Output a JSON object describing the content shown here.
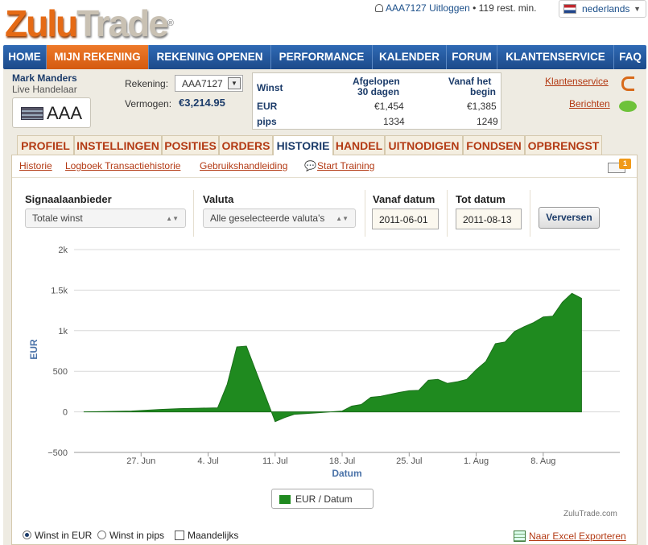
{
  "brand": {
    "logo_part1": "Zulu",
    "logo_part2": "Trade",
    "reg": "®"
  },
  "topbar": {
    "user": "AAA7127",
    "logout": "Uitloggen",
    "remaining": "• 119 rest. min.",
    "language": "nederlands",
    "lang_flag": "dutch-flag-icon"
  },
  "nav": [
    "HOME",
    "MIJN REKENING",
    "REKENING OPENEN",
    "PERFORMANCE",
    "KALENDER",
    "FORUM",
    "KLANTENSERVICE",
    "FAQ"
  ],
  "account": {
    "name": "Mark Manders",
    "type": "Live Handelaar",
    "badge": "AAA",
    "rekening_label": "Rekening:",
    "rekening_value": "AAA7127",
    "vermogen_label": "Vermogen:",
    "vermogen_value": "€3,214.95"
  },
  "stats": {
    "h_winst": "Winst",
    "h_col1": "Afgelopen",
    "h_col1b": "30 dagen",
    "h_col2": "Vanaf het",
    "h_col2b": "begin",
    "eur_label": "EUR",
    "eur_30": "€1,454",
    "eur_all": "€1,385",
    "pips_label": "pips",
    "pips_30": "1334",
    "pips_all": "1249"
  },
  "right_links": {
    "klantenservice": "Klantenservice",
    "berichten": "Berichten"
  },
  "tabs": [
    "PROFIEL",
    "INSTELLINGEN",
    "POSITIES",
    "ORDERS",
    "HISTORIE",
    "HANDEL",
    "UITNODIGEN",
    "FONDSEN",
    "OPBRENGST"
  ],
  "subnav": {
    "historie": "Historie",
    "logboek": "Logboek Transactiehistorie",
    "handleiding": "Gebruikshandleiding",
    "training": "Start Training",
    "mail_count": "1"
  },
  "filters": {
    "signal_label": "Signaalaanbieder",
    "signal_value": "Totale winst",
    "valuta_label": "Valuta",
    "valuta_value": "Alle geselecteerde valuta's",
    "from_label": "Vanaf datum",
    "from_value": "2011-06-01",
    "to_label": "Tot datum",
    "to_value": "2011-08-13",
    "refresh": "Verversen"
  },
  "chart_data": {
    "type": "area",
    "ylabel": "EUR",
    "xlabel": "Datum",
    "ylim": [
      -500,
      2000
    ],
    "yticks": [
      "2k",
      "1.5k",
      "1k",
      "500",
      "0",
      "−500"
    ],
    "xticks": [
      "27. Jun",
      "4. Jul",
      "11. Jul",
      "18. Jul",
      "25. Jul",
      "1. Aug",
      "8. Aug"
    ],
    "legend": "EUR / Datum",
    "color": "#1f8a1f",
    "grid": true,
    "series": [
      {
        "name": "EUR / Datum",
        "x": [
          "2011-06-21",
          "2011-06-26",
          "2011-06-29",
          "2011-07-01",
          "2011-07-03",
          "2011-07-05",
          "2011-07-06",
          "2011-07-07",
          "2011-07-08",
          "2011-07-11",
          "2011-07-12",
          "2011-07-13",
          "2011-07-15",
          "2011-07-18",
          "2011-07-19",
          "2011-07-20",
          "2011-07-21",
          "2011-07-22",
          "2011-07-23",
          "2011-07-24",
          "2011-07-25",
          "2011-07-26",
          "2011-07-27",
          "2011-07-28",
          "2011-07-29",
          "2011-07-30",
          "2011-07-31",
          "2011-08-01",
          "2011-08-02",
          "2011-08-03",
          "2011-08-04",
          "2011-08-05",
          "2011-08-06",
          "2011-08-07",
          "2011-08-08",
          "2011-08-09",
          "2011-08-10",
          "2011-08-11",
          "2011-08-12"
        ],
        "values": [
          0,
          10,
          30,
          40,
          45,
          50,
          340,
          800,
          810,
          -120,
          -70,
          -30,
          -15,
          10,
          70,
          90,
          180,
          190,
          215,
          240,
          260,
          265,
          390,
          400,
          350,
          370,
          400,
          520,
          620,
          840,
          860,
          990,
          1050,
          1100,
          1170,
          1180,
          1350,
          1460,
          1400
        ]
      }
    ]
  },
  "chart_credit": "ZuluTrade.com",
  "bottom": {
    "opt1": "Winst in EUR",
    "opt2": "Winst in pips",
    "opt3": "Maandelijks",
    "export": "Naar Excel Exporteren"
  }
}
